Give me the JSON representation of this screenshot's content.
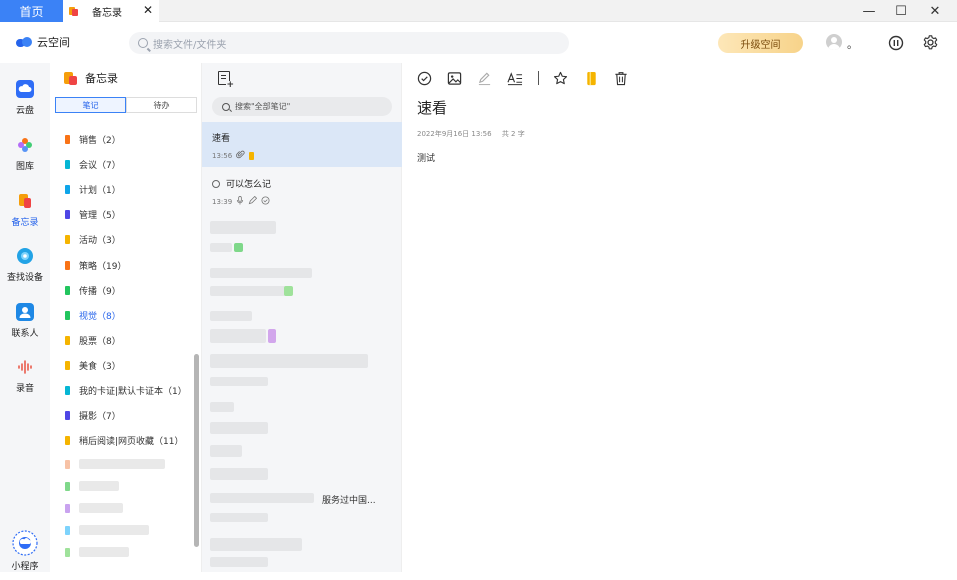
{
  "titlebar": {
    "home_tab": "首页",
    "doc_tab": "备忘录",
    "close_glyph": "✕",
    "window_controls": {
      "minimize": "—",
      "maximize": "☐",
      "close": "✕"
    }
  },
  "header": {
    "brand": "云空间",
    "search_placeholder": "搜索文件/文件夹",
    "upgrade_label": "升级空间",
    "username": "。"
  },
  "rail": {
    "items": [
      {
        "label": "云盘",
        "icon": "cloud-drive-icon",
        "color": "#2f6df6"
      },
      {
        "label": "图库",
        "icon": "gallery-icon",
        "color": "#f97316"
      },
      {
        "label": "备忘录",
        "icon": "memo-icon",
        "color": "#f59e0b"
      },
      {
        "label": "查找设备",
        "icon": "find-device-icon",
        "color": "#22a3e6"
      },
      {
        "label": "联系人",
        "icon": "contacts-icon",
        "color": "#1e88e5"
      },
      {
        "label": "录音",
        "icon": "recorder-icon",
        "color": "#e95b4c"
      },
      {
        "label": "小程序",
        "icon": "mini-program-icon",
        "color": "#2f6df6"
      }
    ]
  },
  "folders": {
    "title": "备忘录",
    "tabs": [
      "笔记",
      "待办"
    ],
    "items": [
      {
        "label": "销售（2）",
        "color": "#f97316"
      },
      {
        "label": "会议（7）",
        "color": "#06b6d4"
      },
      {
        "label": "计划（1）",
        "color": "#0ea5e9"
      },
      {
        "label": "管理（5）",
        "color": "#4f46e5"
      },
      {
        "label": "活动（3）",
        "color": "#f5b400"
      },
      {
        "label": "策略（19）",
        "color": "#f97316"
      },
      {
        "label": "传播（9）",
        "color": "#22c55e"
      },
      {
        "label": "视觉（8）",
        "color": "#22c55e"
      },
      {
        "label": "股票（8）",
        "color": "#f5b400"
      },
      {
        "label": "美食（3）",
        "color": "#f5b400"
      },
      {
        "label": "我的卡证|默认卡证本（1）",
        "color": "#06b6d4"
      },
      {
        "label": "摄影（7）",
        "color": "#4f46e5"
      },
      {
        "label": "稍后阅读|网页收藏（11）",
        "color": "#f5b400"
      }
    ]
  },
  "notes": {
    "search_placeholder": "搜索\"全部笔记\"",
    "cards": [
      {
        "title": "速看",
        "time": "13:56"
      },
      {
        "title": "可以怎么记",
        "time": "13:39"
      }
    ],
    "partial_title": "服务过中国..."
  },
  "editor": {
    "title": "速看",
    "date": "2022年9月16日 13:56",
    "word_count": "共 2 字",
    "body": "测试"
  }
}
